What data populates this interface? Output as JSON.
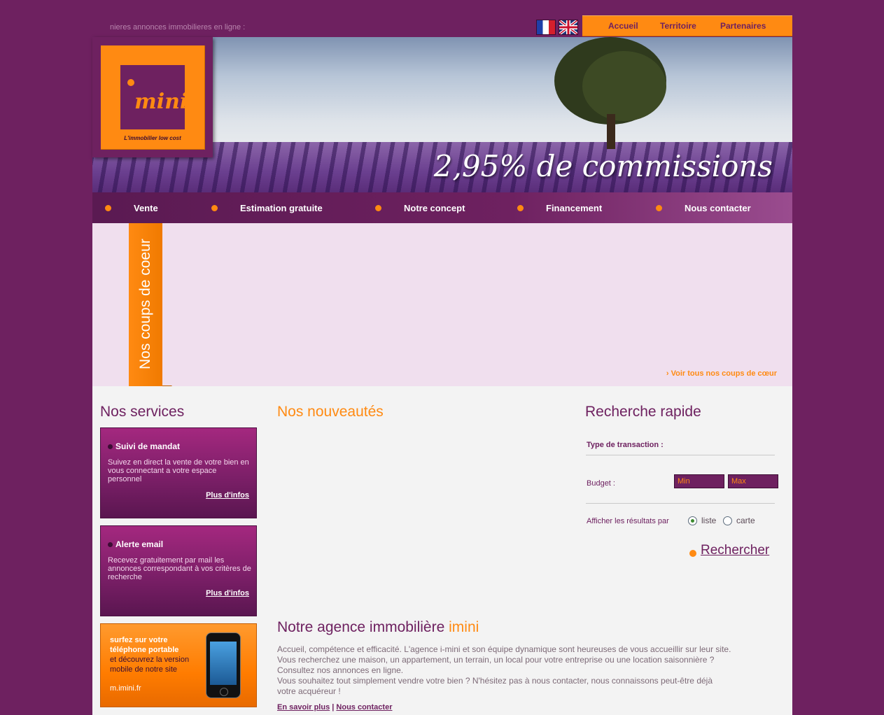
{
  "ticker": "nieres annonces immobilieres en ligne :",
  "languages": [
    "fr",
    "en"
  ],
  "top_nav": [
    "Accueil",
    "Territoire",
    "Partenaires"
  ],
  "logo": {
    "name": "mini",
    "tagline": "L'immobilier low cost"
  },
  "banner": {
    "tagline": "2,95% de commissions"
  },
  "main_nav": [
    "Vente",
    "Estimation gratuite",
    "Notre concept",
    "Financement",
    "Nous contacter"
  ],
  "favorites": {
    "ribbon": "Nos coups de coeur",
    "link": "› Voir tous nos coups de cœur"
  },
  "services": {
    "title": "Nos services",
    "cards": [
      {
        "title": "Suivi de mandat",
        "desc": "Suivez en direct la vente de votre bien en vous connectant a votre espace personnel",
        "more": "Plus d'infos"
      },
      {
        "title": "Alerte email",
        "desc": "Recevez gratuitement par mail les annonces correspondant à vos critères de recherche",
        "more": "Plus d'infos"
      }
    ],
    "mobile": {
      "line1": "surfez sur votre téléphone portable",
      "line2": "et découvrez la version mobile de notre site",
      "url": "m.imini.fr"
    }
  },
  "news": {
    "title": "Nos nouveautés"
  },
  "quick_search": {
    "title": "Recherche rapide",
    "transaction_label": "Type de transaction :",
    "budget_label": "Budget :",
    "min_placeholder": "Min",
    "max_placeholder": "Max",
    "display_label": "Afficher les résultats par",
    "option_list": "liste",
    "option_map": "carte",
    "selected": "liste",
    "button": "Rechercher"
  },
  "agency": {
    "title_prefix": "Notre agence immobilière",
    "title_highlight": "imini",
    "paragraphs": [
      "Accueil, compétence et efficacité. L'agence i-mini et son équipe dynamique sont heureuses de vous accueillir sur leur site.",
      "Vous recherchez une maison, un appartement, un terrain, un local pour votre entreprise ou une location saisonnière ?",
      "Consultez nos annonces en ligne.",
      "Vous souhaitez tout simplement vendre votre bien ? N'hésitez pas à nous contacter, nous connaissons peut-être déjà votre acquéreur !"
    ],
    "link_more": "En savoir plus",
    "separator": "|",
    "link_contact": "Nous contacter"
  },
  "colors": {
    "purple": "#6e2160",
    "orange": "#ff8a12",
    "pink_bg": "#f0dfee"
  }
}
